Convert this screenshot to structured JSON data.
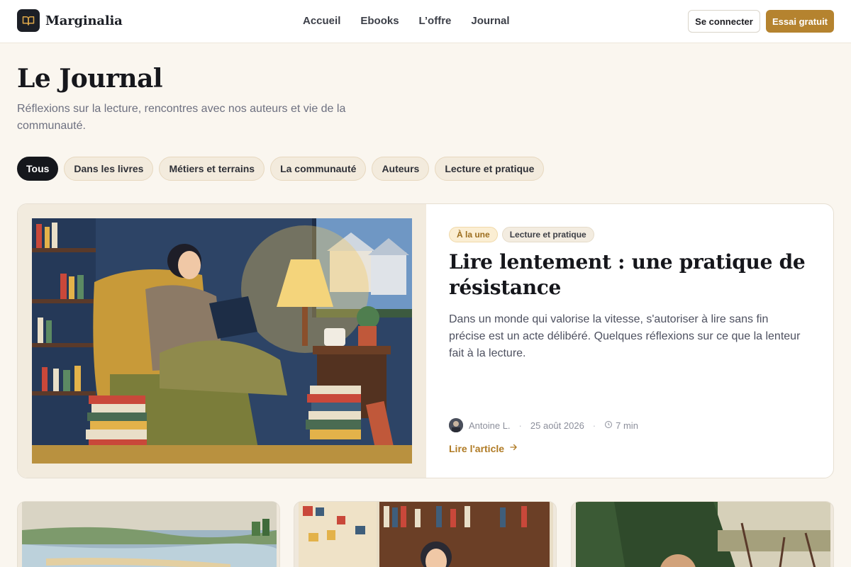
{
  "brand": {
    "name": "Marginalia",
    "icon": "open-book-icon"
  },
  "nav": {
    "items": [
      "Accueil",
      "Ebooks",
      "L’offre",
      "Journal"
    ]
  },
  "header_actions": {
    "login": "Se connecter",
    "trial": "Essai gratuit"
  },
  "page": {
    "title": "Le Journal",
    "subtitle": "Réflexions sur la lecture, rencontres avec nos auteurs et vie de la communauté."
  },
  "filters": {
    "active": "Tous",
    "items": [
      "Tous",
      "Dans les livres",
      "Métiers et terrains",
      "La communauté",
      "Auteurs",
      "Lecture et pratique"
    ]
  },
  "featured": {
    "badge": "À la une",
    "category": "Lecture et pratique",
    "title": "Lire lentement : une pratique de résistance",
    "excerpt": "Dans un monde qui valorise la vitesse, s'autoriser à lire sans fin précise est un acte délibéré. Quelques réflexions sur ce que la lenteur fait à la lecture.",
    "author": "Antoine L.",
    "date": "25 août 2026",
    "read_time": "7 min",
    "link_label": "Lire l'article"
  },
  "colors": {
    "accent": "#b5832f",
    "dark": "#15171c",
    "background": "#faf6ef"
  }
}
